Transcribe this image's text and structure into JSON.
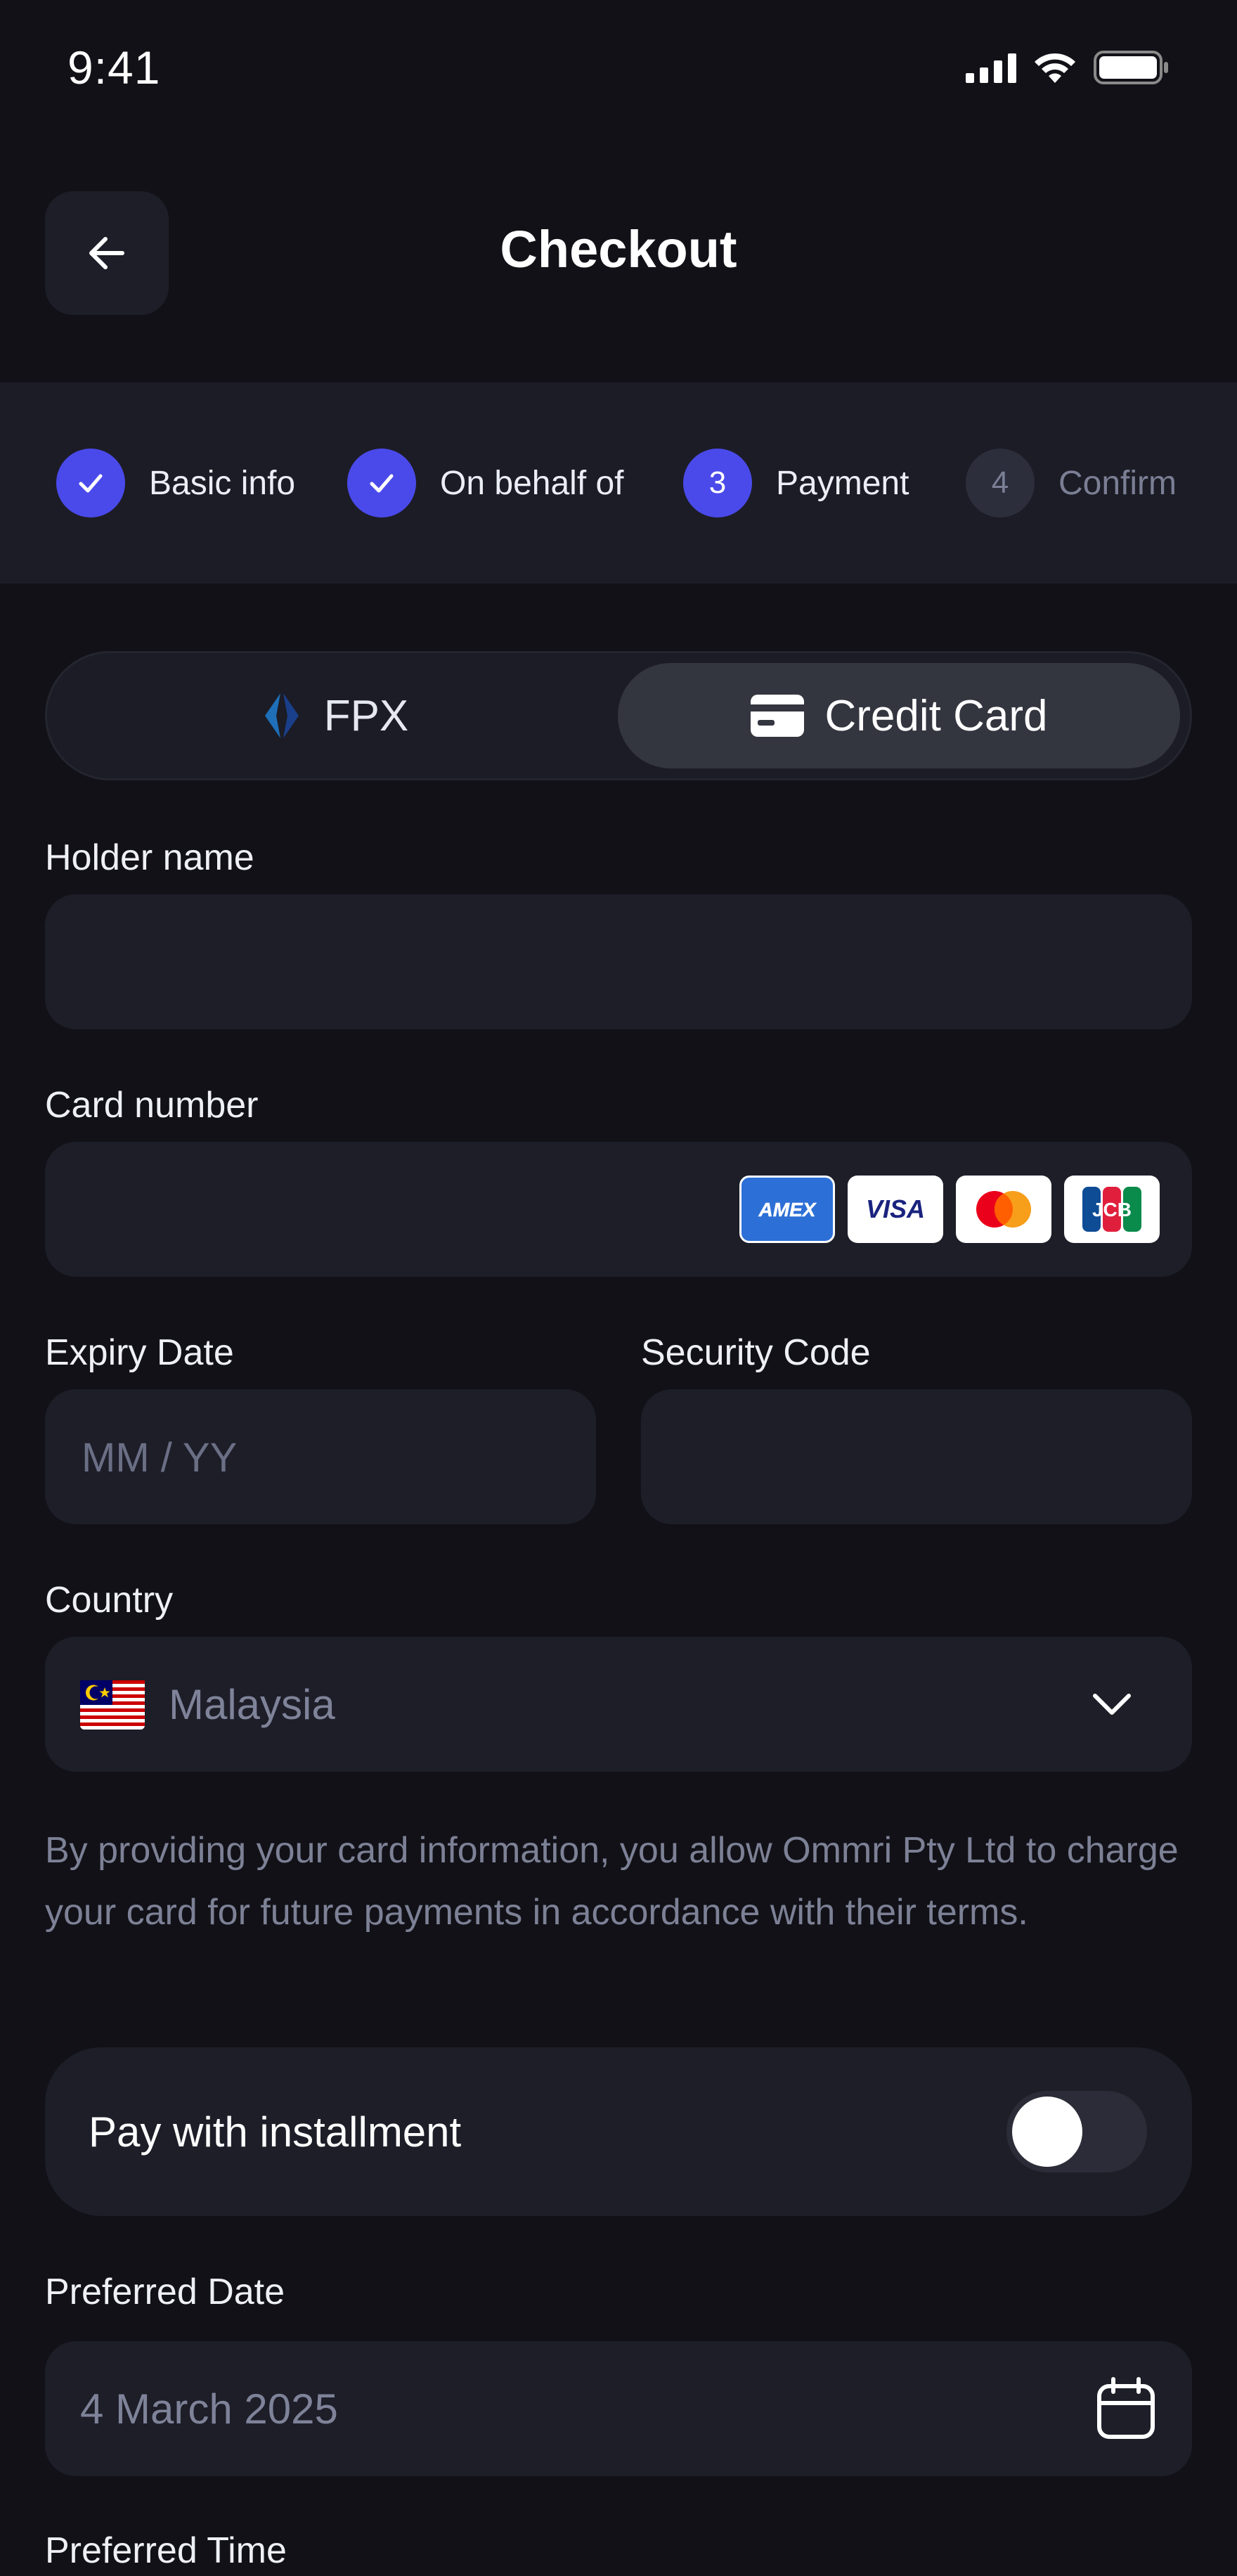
{
  "status_bar": {
    "time": "9:41"
  },
  "header": {
    "title": "Checkout"
  },
  "stepper": {
    "steps": [
      {
        "label": "Basic info",
        "state": "done",
        "number": ""
      },
      {
        "label": "On behalf of",
        "state": "done",
        "number": ""
      },
      {
        "label": "Payment",
        "state": "active",
        "number": "3"
      },
      {
        "label": "Confirm",
        "state": "pending",
        "number": "4"
      }
    ]
  },
  "payment_method": {
    "options": [
      {
        "label": "FPX",
        "selected": false
      },
      {
        "label": "Credit Card",
        "selected": true
      }
    ]
  },
  "form": {
    "holder_name": {
      "label": "Holder name",
      "value": "",
      "placeholder": ""
    },
    "card_number": {
      "label": "Card number",
      "value": "",
      "placeholder": "",
      "card_brands": [
        "AMEX",
        "VISA",
        "mastercard",
        "JCB"
      ]
    },
    "expiry": {
      "label": "Expiry Date",
      "value": "",
      "placeholder": "MM / YY"
    },
    "security_code": {
      "label": "Security Code",
      "value": "",
      "placeholder": ""
    },
    "country": {
      "label": "Country",
      "value": "Malaysia",
      "flag_icon": "malaysia-flag-icon"
    },
    "consent_text": "By providing your card information, you allow Ommri Pty Ltd to charge your card for future payments in accordance with their terms.",
    "installment": {
      "label": "Pay with installment",
      "enabled": false
    },
    "preferred_date": {
      "label": "Preferred Date",
      "value": "4 March 2025"
    },
    "preferred_time": {
      "label": "Preferred Time"
    }
  },
  "colors": {
    "background": "#111117",
    "surface": "#1d1e28",
    "accent": "#4a4aeb",
    "muted_text": "#7d8196"
  }
}
